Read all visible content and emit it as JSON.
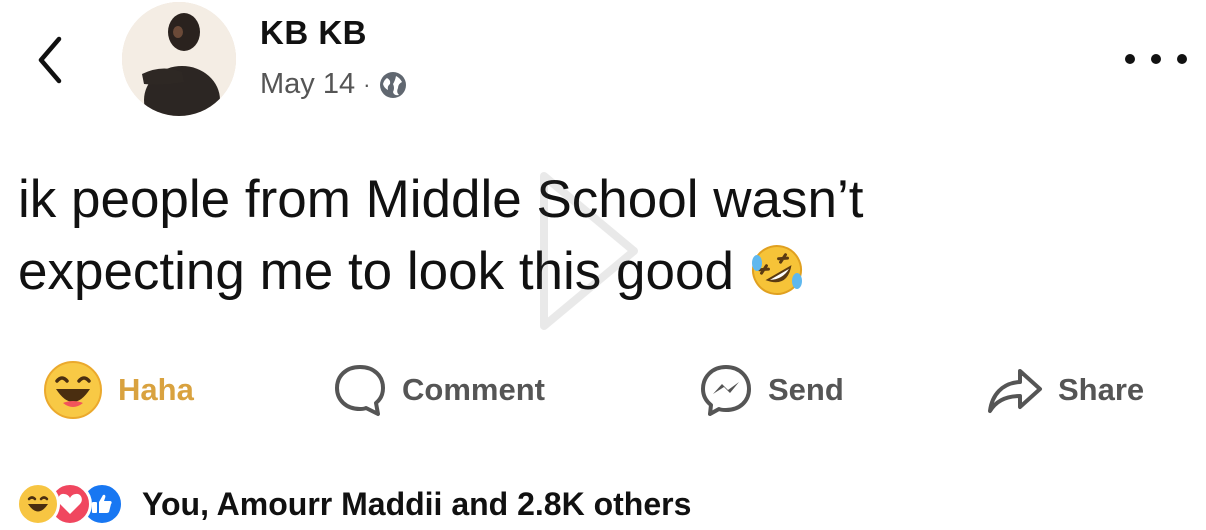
{
  "post": {
    "author": "KB KB",
    "date": "May 14",
    "separator": "·",
    "text_line1": "ik people from Middle School wasn’t",
    "text_line2": "expecting me to look this good"
  },
  "actions": {
    "haha_label": "Haha",
    "comment_label": "Comment",
    "send_label": "Send",
    "share_label": "Share"
  },
  "reactions": {
    "summary": "You, Amourr Maddii and 2.8K others",
    "icons": [
      "haha-icon",
      "love-icon",
      "like-icon"
    ]
  },
  "icons": {
    "back": "chevron-left-icon",
    "privacy": "globe-icon",
    "more": "more-horizontal-icon",
    "post_emoji": "rolling-on-floor-laughing-emoji"
  },
  "colors": {
    "haha_active": "#d9a23f",
    "love": "#f0465f",
    "like": "#1877f2",
    "text": "#111111",
    "muted": "#555555"
  }
}
